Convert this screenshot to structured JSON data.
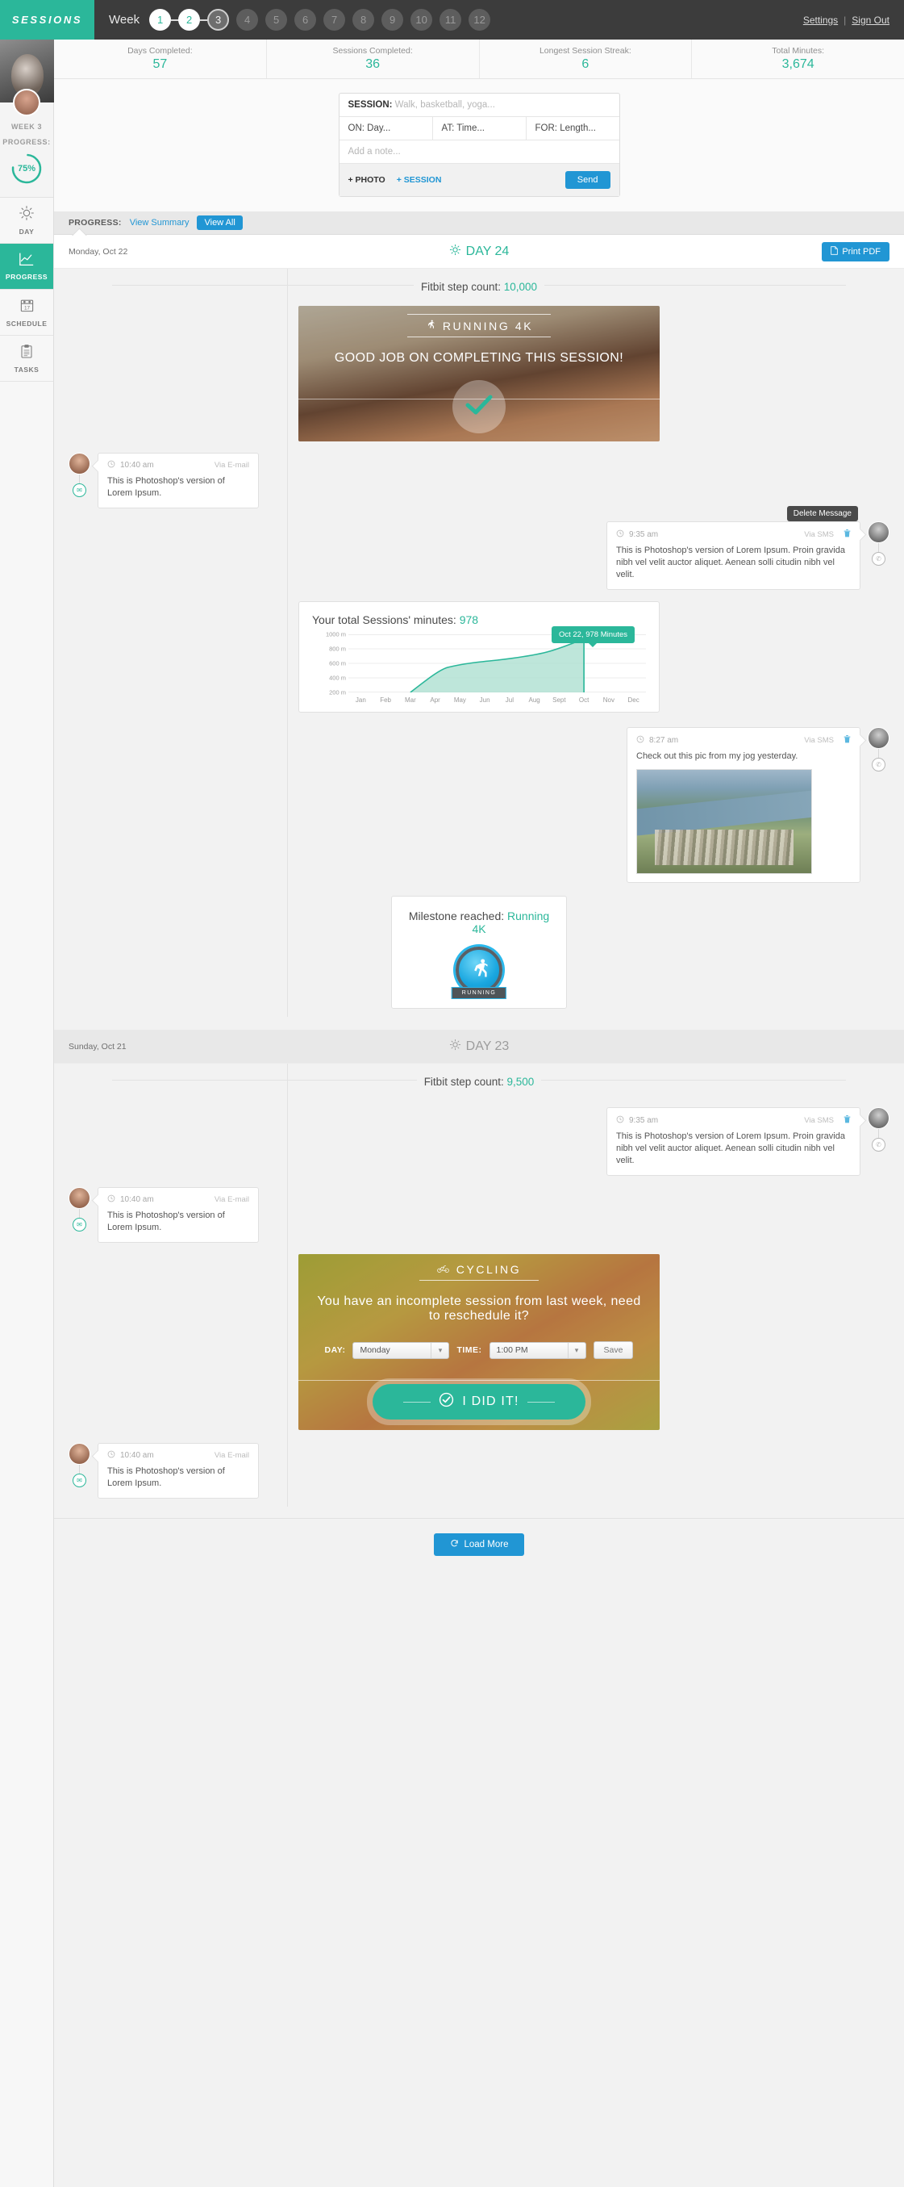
{
  "brand": "SESSIONS",
  "header": {
    "week_label": "Week",
    "weeks": [
      {
        "n": "1",
        "state": "done"
      },
      {
        "n": "2",
        "state": "done"
      },
      {
        "n": "3",
        "state": "current"
      },
      {
        "n": "4",
        "state": "future"
      },
      {
        "n": "5",
        "state": "future"
      },
      {
        "n": "6",
        "state": "future"
      },
      {
        "n": "7",
        "state": "future"
      },
      {
        "n": "8",
        "state": "future"
      },
      {
        "n": "9",
        "state": "future"
      },
      {
        "n": "10",
        "state": "future"
      },
      {
        "n": "11",
        "state": "future"
      },
      {
        "n": "12",
        "state": "future"
      }
    ],
    "settings": "Settings",
    "separator": "|",
    "signout": "Sign Out",
    "accent": "#2bb79a"
  },
  "stats": [
    {
      "label": "Days Completed:",
      "value": "57"
    },
    {
      "label": "Sessions Completed:",
      "value": "36"
    },
    {
      "label": "Longest Session Streak:",
      "value": "6"
    },
    {
      "label": "Total Minutes:",
      "value": "3,674"
    }
  ],
  "sidebar": {
    "week_progress_label": "WEEK 3\nPROGRESS:",
    "week_progress_line1": "WEEK 3",
    "week_progress_line2": "PROGRESS:",
    "progress_percent": "75%",
    "progress_value": 75,
    "items": [
      {
        "label": "DAY",
        "icon": "sun-icon",
        "active": false
      },
      {
        "label": "PROGRESS",
        "icon": "chart-line-icon",
        "active": true
      },
      {
        "label": "SCHEDULE",
        "icon": "calendar-icon",
        "active": false
      },
      {
        "label": "TASKS",
        "icon": "clipboard-icon",
        "active": false
      }
    ]
  },
  "composer": {
    "session_label": "SESSION:",
    "session_placeholder": "Walk, basketball, yoga...",
    "on_label": "ON:",
    "on_placeholder": "Day...",
    "at_label": "AT:",
    "at_placeholder": "Time...",
    "for_label": "FOR:",
    "for_placeholder": "Length...",
    "note_placeholder": "Add a note...",
    "add_photo": "+ PHOTO",
    "add_session": "+ SESSION",
    "send": "Send"
  },
  "progress_bar": {
    "label": "PROGRESS:",
    "view_summary": "View Summary",
    "view_all": "View All"
  },
  "days": [
    {
      "date": "Monday, Oct 22",
      "title": "DAY 24",
      "print_pdf": "Print PDF",
      "step_count_label": "Fitbit step count:",
      "step_count_value": "10,000"
    },
    {
      "date": "Sunday, Oct 21",
      "title": "DAY 23",
      "step_count_label": "Fitbit step count:",
      "step_count_value": "9,500"
    }
  ],
  "hero_running": {
    "kind": "RUNNING 4K",
    "icon": "running-icon",
    "message": "GOOD JOB ON COMPLETING THIS SESSION!"
  },
  "hero_cycling": {
    "kind": "CYCLING",
    "icon": "bicycle-icon",
    "message": "You have an incomplete session from last week, need to reschedule it?",
    "day_label": "DAY:",
    "day_value": "Monday",
    "time_label": "TIME:",
    "time_value": "1:00 PM",
    "save": "Save",
    "did_it": "I DID IT!"
  },
  "messages_day24": [
    {
      "side": "left",
      "time": "10:40 am",
      "via": "Via E-mail",
      "text": "This is Photoshop's version  of Lorem Ipsum.",
      "badge": "envelope-icon"
    },
    {
      "side": "right",
      "time": "9:35 am",
      "via": "Via SMS",
      "text": "This is Photoshop's version  of Lorem Ipsum. Proin gravida nibh vel velit auctor aliquet. Aenean solli citudin nibh vel velit.",
      "badge": "sms-icon",
      "delete_tooltip": "Delete Message"
    },
    {
      "side": "right",
      "time": "8:27 am",
      "via": "Via SMS",
      "text": "Check out this pic from my jog yesterday.",
      "badge": "sms-icon",
      "has_photo": true
    }
  ],
  "messages_day23": [
    {
      "side": "right",
      "time": "9:35 am",
      "via": "Via SMS",
      "text": "This is Photoshop's version  of Lorem Ipsum. Proin gravida nibh vel velit auctor aliquet. Aenean solli citudin nibh vel velit.",
      "badge": "sms-icon"
    },
    {
      "side": "left",
      "time": "10:40 am",
      "via": "Via E-mail",
      "text": "This is Photoshop's version  of Lorem Ipsum.",
      "badge": "envelope-icon"
    },
    {
      "side": "left",
      "time": "10:40 am",
      "via": "Via E-mail",
      "text": "This is Photoshop's version  of Lorem Ipsum.",
      "badge": "envelope-icon"
    }
  ],
  "milestone": {
    "label": "Milestone reached:",
    "value": "Running 4K",
    "badge_text": "RUNNING"
  },
  "load_more": "Load More",
  "chart_data": {
    "type": "area",
    "title_prefix": "Your total Sessions' minutes:",
    "title_value": "978",
    "categories": [
      "Jan",
      "Feb",
      "Mar",
      "Apr",
      "May",
      "Jun",
      "Jul",
      "Aug",
      "Sept",
      "Oct",
      "Nov",
      "Dec"
    ],
    "values": [
      null,
      null,
      200,
      400,
      450,
      490,
      520,
      560,
      700,
      915,
      null,
      null
    ],
    "ytick_labels": [
      "1000 m",
      "800 m",
      "600 m",
      "400 m",
      "200 m"
    ],
    "yticks": [
      1000,
      800,
      600,
      400,
      200
    ],
    "ylim": [
      200,
      1000
    ],
    "grid": true,
    "legend": "none",
    "annotation": "Oct 22, 978 Minutes",
    "series_color": "#2bb79a",
    "fill_color": "#a8ddcd"
  }
}
